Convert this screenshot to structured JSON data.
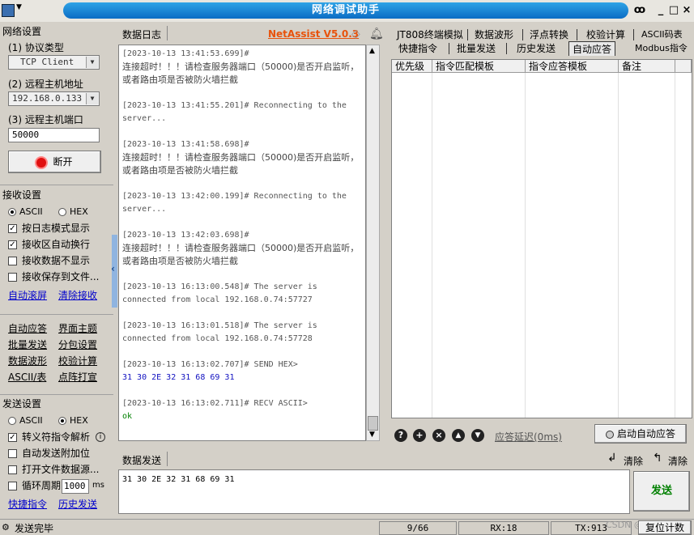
{
  "window": {
    "title": "网络调试助手"
  },
  "net": {
    "section": "网络设置",
    "protocol_label": "(1) 协议类型",
    "protocol": "TCP Client",
    "host_label": "(2) 远程主机地址",
    "host": "192.168.0.133",
    "port_label": "(3) 远程主机端口",
    "port": "50000",
    "disconnect": "断开"
  },
  "recv": {
    "section": "接收设置",
    "ascii": "ASCII",
    "hex": "HEX",
    "log_mode": "按日志模式显示",
    "auto_wrap": "接收区自动换行",
    "hide": "接收数据不显示",
    "save": "接收保存到文件...",
    "auto_scroll": "自动滚屏",
    "clear": "清除接收"
  },
  "tools": [
    "自动应答",
    "界面主题",
    "批量发送",
    "分包设置",
    "数据波形",
    "校验计算",
    "ASCII/表",
    "点阵打宣"
  ],
  "send": {
    "section": "发送设置",
    "ascii": "ASCII",
    "hex": "HEX",
    "escape": "转义符指令解析",
    "auto_append": "自动发送附加位",
    "file_source": "打开文件数据源...",
    "cycle": "循环周期",
    "cycle_value": "1000",
    "cycle_unit": "ms",
    "quick": "快捷指令",
    "history": "历史发送"
  },
  "log": {
    "title": "数据日志",
    "brand": "NetAssist V5.0.3",
    "entries": [
      {
        "ts": "[2023-10-13 13:41:53.699]# ",
        "msg": "连接超时！！！请检查服务器端口（50000)是否开启监听，或者路由项是否被防火墙拦截"
      },
      {
        "ts": "[2023-10-13 13:41:55.201]# Reconnecting to the server..."
      },
      {
        "ts": "[2023-10-13 13:41:58.698]# ",
        "msg": "连接超时！！！请检查服务器端口（50000)是否开启监听，或者路由项是否被防火墙拦截"
      },
      {
        "ts": "[2023-10-13 13:42:00.199]# Reconnecting to the server..."
      },
      {
        "ts": "[2023-10-13 13:42:03.698]# ",
        "msg": "连接超时！！！请检查服务器端口（50000)是否开启监听，或者路由项是否被防火墙拦截"
      },
      {
        "ts": "[2023-10-13 16:13:00.548]# The server is connected from local 192.168.0.74:57727"
      },
      {
        "ts": "[2023-10-13 16:13:01.518]# The server is connected from local 192.168.0.74:57728"
      },
      {
        "ts": "[2023-10-13 16:13:02.707]# SEND HEX>",
        "data": "31 30 2E 32 31 68 69 31"
      },
      {
        "ts": "[2023-10-13 16:13:02.711]# RECV ASCII>",
        "recv": "ok"
      }
    ]
  },
  "right": {
    "tabs_top": [
      "JT808终端模拟",
      "数据波形",
      "浮点转换",
      "校验计算",
      "ASCII码表"
    ],
    "tabs_bottom": [
      "快捷指令",
      "批量发送",
      "历史发送",
      "自动应答",
      "Modbus指令"
    ],
    "columns": [
      "优先级",
      "指令匹配模板",
      "指令应答模板",
      "备注"
    ],
    "delay_label": "应答延迟(0ms)",
    "start_button": "启动自动应答"
  },
  "sendarea": {
    "title": "数据发送",
    "clear1": "清除",
    "clear2": "清除",
    "content": "31 30 2E 32 31 68 69 31",
    "send_button": "发送"
  },
  "status": {
    "text": "发送完毕",
    "count": "9/66",
    "rx": "RX:18",
    "tx": "TX:913",
    "reset": "复位计数",
    "watermark": "CSDN @一三乙"
  }
}
